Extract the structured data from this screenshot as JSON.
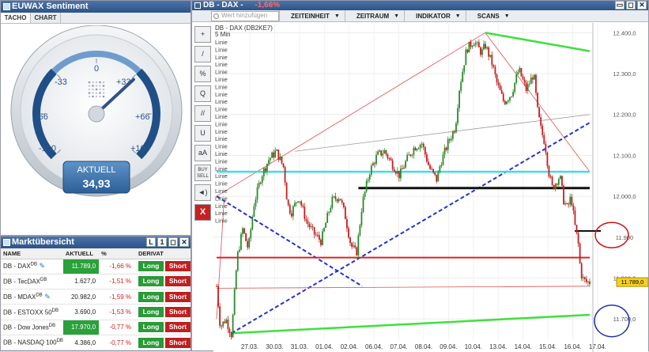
{
  "sentiment": {
    "title": "EUWAX Sentiment",
    "tabs": [
      "TACHO",
      "CHART"
    ],
    "gauge": {
      "labels": [
        "-100",
        "-66",
        "-33",
        "0",
        "+33",
        "+66",
        "+100"
      ],
      "aktuell_label": "AKTUELL",
      "value": "34,93",
      "needle_value": 34.93
    }
  },
  "market": {
    "title": "Marktübersicht",
    "columns": [
      "NAME",
      "AKTUELL",
      "%",
      "DERIVAT"
    ],
    "rows": [
      {
        "name": "DB - DAX",
        "sup": "DB",
        "value": "11.789,0",
        "pct": "-1,66 %",
        "highlight": true,
        "pen": true
      },
      {
        "name": "DB - TecDAX",
        "sup": "DB",
        "value": "1.627,0",
        "pct": "-1,51 %",
        "highlight": false,
        "pen": false
      },
      {
        "name": "DB - MDAX",
        "sup": "DB",
        "value": "20.982,0",
        "pct": "-1,59 %",
        "highlight": false,
        "pen": true
      },
      {
        "name": "DB - ESTOXX 50",
        "sup": "DB",
        "value": "3.690,0",
        "pct": "-1,53 %",
        "highlight": false,
        "pen": false
      },
      {
        "name": "DB - Dow Jones",
        "sup": "DB",
        "value": "17.970,0",
        "pct": "-0,77 %",
        "highlight": true,
        "pen": false
      },
      {
        "name": "DB - NASDAQ 100",
        "sup": "DB",
        "value": "4.386,0",
        "pct": "-0,77 %",
        "highlight": false,
        "pen": false
      }
    ],
    "long_label": "Long",
    "short_label": "Short"
  },
  "chart": {
    "title": "DB - DAX -",
    "change": "-1,66%",
    "search_placeholder": "Wert hinzufügen",
    "toolbar": [
      "ZEITEINHEIT",
      "ZEITRAUM",
      "INDIKATOR",
      "SCANS"
    ],
    "tools": [
      "+",
      "/",
      "%",
      "Q",
      "//",
      "U",
      "aA",
      "BUY SELL",
      "◄)",
      "X"
    ],
    "legend_line1": "DB - DAX (DB2KE7)",
    "legend_line2": "5 Min",
    "linie_label": "Linie",
    "linie_count": 25,
    "price_marker": "11.789,0",
    "colors": {
      "candle_up": "#2a8a2a",
      "candle_down": "#c41e1e",
      "accent": "#2e5487"
    }
  },
  "chart_data": {
    "type": "candlestick",
    "title": "DB - DAX (DB2KE7)",
    "interval": "5 Min",
    "yticks": [
      "12.400,0",
      "12.300,0",
      "12.200,0",
      "12.100,0",
      "12.000,0",
      "11.900",
      "11.800,0",
      "11.700,0"
    ],
    "ytick_values": [
      12400,
      12300,
      12200,
      12100,
      12000,
      11900,
      11800,
      11700
    ],
    "ylim": [
      11650,
      12420
    ],
    "xticks": [
      "27.03.",
      "30.03.",
      "31.03.",
      "01.04.",
      "02.04.",
      "06.04.",
      "07.04.",
      "08.04.",
      "09.04.",
      "10.04.",
      "13.04.",
      "14.04.",
      "15.04.",
      "16.04.",
      "17.04."
    ],
    "close_path": [
      [
        0,
        11780
      ],
      [
        0.01,
        11680
      ],
      [
        0.025,
        11700
      ],
      [
        0.04,
        11660
      ],
      [
        0.055,
        11850
      ],
      [
        0.07,
        11920
      ],
      [
        0.085,
        11870
      ],
      [
        0.1,
        11980
      ],
      [
        0.12,
        12050
      ],
      [
        0.14,
        12090
      ],
      [
        0.16,
        12110
      ],
      [
        0.18,
        12070
      ],
      [
        0.19,
        11980
      ],
      [
        0.2,
        11960
      ],
      [
        0.22,
        12000
      ],
      [
        0.24,
        11940
      ],
      [
        0.26,
        11910
      ],
      [
        0.28,
        11890
      ],
      [
        0.3,
        11960
      ],
      [
        0.31,
        11990
      ],
      [
        0.33,
        12000
      ],
      [
        0.345,
        11950
      ],
      [
        0.36,
        11880
      ],
      [
        0.375,
        11860
      ],
      [
        0.39,
        11980
      ],
      [
        0.41,
        12060
      ],
      [
        0.43,
        12100
      ],
      [
        0.45,
        12110
      ],
      [
        0.47,
        12080
      ],
      [
        0.49,
        12050
      ],
      [
        0.51,
        12090
      ],
      [
        0.53,
        12120
      ],
      [
        0.55,
        12130
      ],
      [
        0.57,
        12070
      ],
      [
        0.59,
        12040
      ],
      [
        0.6,
        12080
      ],
      [
        0.62,
        12130
      ],
      [
        0.64,
        12170
      ],
      [
        0.65,
        12260
      ],
      [
        0.67,
        12360
      ],
      [
        0.69,
        12380
      ],
      [
        0.71,
        12350
      ],
      [
        0.72,
        12370
      ],
      [
        0.74,
        12320
      ],
      [
        0.75,
        12280
      ],
      [
        0.77,
        12230
      ],
      [
        0.79,
        12250
      ],
      [
        0.81,
        12310
      ],
      [
        0.83,
        12260
      ],
      [
        0.85,
        12300
      ],
      [
        0.86,
        12210
      ],
      [
        0.87,
        12160
      ],
      [
        0.88,
        12130
      ],
      [
        0.89,
        12060
      ],
      [
        0.9,
        12020
      ],
      [
        0.92,
        12050
      ],
      [
        0.93,
        11990
      ],
      [
        0.94,
        11970
      ],
      [
        0.95,
        12000
      ],
      [
        0.96,
        11930
      ],
      [
        0.97,
        11880
      ],
      [
        0.975,
        11820
      ],
      [
        0.98,
        11800
      ],
      [
        0.99,
        11790
      ]
    ],
    "last_price": 11789.0,
    "drawn_levels": [
      12060,
      12020,
      11915,
      11850,
      11780
    ]
  }
}
